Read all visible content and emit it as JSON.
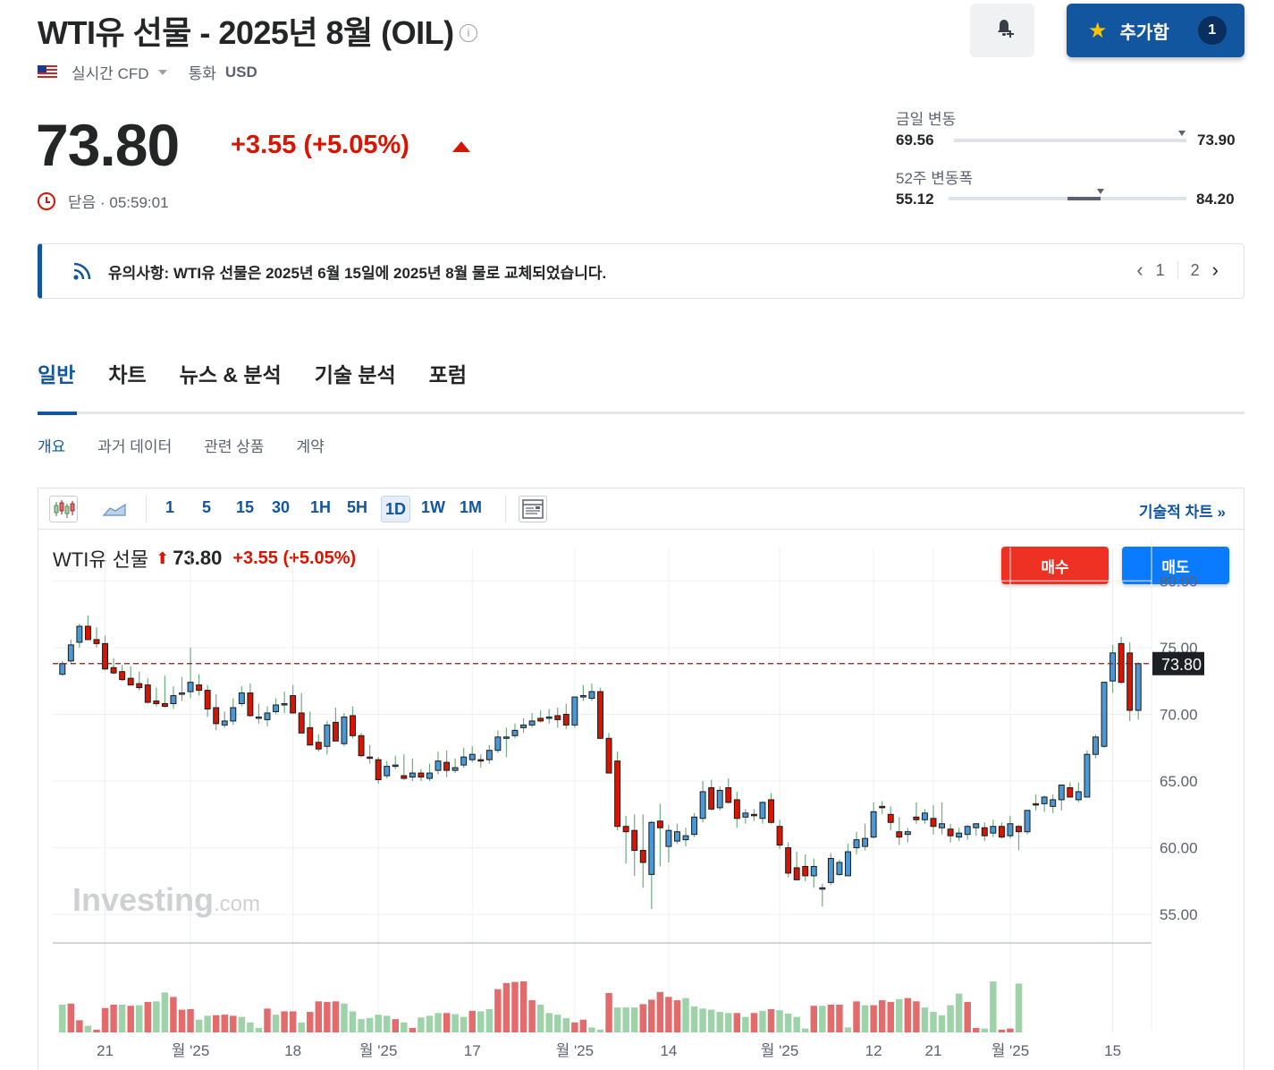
{
  "header": {
    "title": "WTI유 선물 - 2025년 8월 (OIL)",
    "info_icon": "i",
    "follow_label": "추가함",
    "follow_count": "1"
  },
  "subheader": {
    "market_type": "실시간 CFD",
    "currency_label": "통화",
    "currency": "USD"
  },
  "quote": {
    "price": "73.80",
    "change": "+3.55 (+5.05%)",
    "status": "닫음 · 05:59:01"
  },
  "ranges": {
    "day_label": "금일 변동",
    "day_low": "69.56",
    "day_high": "73.90",
    "day_position": 0.98,
    "week52_label": "52주 변동폭",
    "week52_low": "55.12",
    "week52_high": "84.20",
    "week52_fill_start": 0.5,
    "week52_position": 0.64
  },
  "notice": {
    "text": "유의사항: WTI유 선물은 2025년 6월 15일에 2025년 8월 물로 교체되었습니다.",
    "page_current": "1",
    "page_total": "2"
  },
  "tabs": [
    "일반",
    "차트",
    "뉴스 & 분석",
    "기술 분석",
    "포럼"
  ],
  "subtabs": [
    "개요",
    "과거 데이터",
    "관련 상품",
    "계약"
  ],
  "toolbar": {
    "intervals": [
      "1",
      "5",
      "15",
      "30",
      "1H",
      "5H",
      "1D",
      "1W",
      "1M"
    ],
    "selected_interval": "1D",
    "tech_chart_link": "기술적 차트 »"
  },
  "chart_legend": {
    "name": "WTI유 선물",
    "price": "73.80",
    "change": "+3.55 (+5.05%)"
  },
  "buttons": {
    "buy": "매수",
    "sell": "매도"
  },
  "watermark": {
    "brand": "Investing",
    "suffix": ".com"
  },
  "colors": {
    "accent": "#1256a0",
    "up": "#d91400",
    "candle_up": "#4a98d4",
    "candle_down": "#d91400",
    "volume_up": "#9ed3a9",
    "volume_down": "#e46b6b"
  },
  "chart_data": {
    "type": "candlestick",
    "ylim": [
      53,
      82.5
    ],
    "y_ticks": [
      80,
      75,
      70,
      65,
      60,
      55
    ],
    "y_tick_labels": [
      "80.00",
      "75.00",
      "70.00",
      "65.00",
      "60.00",
      "55.00"
    ],
    "last_price": 73.8,
    "last_price_label": "73.80",
    "x_tick_labels": [
      "21",
      "월 '25",
      "18",
      "월 '25",
      "17",
      "월 '25",
      "14",
      "월 '25",
      "12",
      "21",
      "월 '25",
      "15"
    ],
    "x_tick_positions": [
      5,
      15,
      27,
      37,
      48,
      60,
      71,
      84,
      95,
      102,
      111,
      123
    ],
    "candles": [
      [
        73.0,
        74.0,
        72.9,
        73.8
      ],
      [
        74.0,
        75.6,
        73.8,
        75.2
      ],
      [
        75.4,
        76.8,
        75.0,
        76.6
      ],
      [
        76.6,
        77.4,
        75.9,
        75.6
      ],
      [
        75.6,
        76.5,
        75.0,
        75.3
      ],
      [
        75.3,
        75.9,
        73.3,
        73.4
      ],
      [
        73.5,
        74.2,
        73.0,
        73.1
      ],
      [
        73.2,
        73.7,
        72.5,
        72.6
      ],
      [
        72.7,
        73.6,
        72.2,
        72.2
      ],
      [
        72.3,
        73.2,
        71.8,
        72.0
      ],
      [
        72.2,
        72.7,
        70.8,
        70.9
      ],
      [
        71.0,
        72.0,
        70.6,
        70.8
      ],
      [
        70.8,
        72.9,
        70.5,
        70.6
      ],
      [
        70.8,
        72.1,
        70.4,
        71.4
      ],
      [
        71.6,
        72.8,
        71.0,
        71.6
      ],
      [
        71.7,
        75.0,
        71.2,
        72.4
      ],
      [
        72.2,
        73.0,
        71.4,
        71.8
      ],
      [
        71.8,
        72.2,
        69.8,
        70.4
      ],
      [
        70.5,
        71.5,
        68.8,
        69.3
      ],
      [
        69.2,
        70.2,
        69.0,
        69.5
      ],
      [
        69.5,
        71.2,
        69.2,
        70.5
      ],
      [
        70.8,
        72.1,
        70.6,
        71.6
      ],
      [
        71.6,
        72.3,
        69.8,
        69.9
      ],
      [
        69.7,
        70.8,
        69.3,
        69.8
      ],
      [
        69.6,
        70.6,
        69.1,
        70.1
      ],
      [
        70.2,
        71.2,
        70.0,
        70.7
      ],
      [
        70.8,
        71.7,
        70.1,
        70.8
      ],
      [
        71.4,
        72.2,
        70.8,
        70.1
      ],
      [
        70.1,
        71.6,
        69.3,
        68.6
      ],
      [
        69.0,
        70.2,
        68.3,
        67.7
      ],
      [
        67.9,
        68.5,
        67.2,
        67.4
      ],
      [
        67.6,
        69.5,
        67.0,
        69.2
      ],
      [
        69.4,
        70.5,
        68.1,
        68.0
      ],
      [
        67.8,
        70.1,
        67.6,
        69.8
      ],
      [
        69.9,
        70.6,
        68.2,
        68.4
      ],
      [
        68.4,
        68.6,
        66.8,
        66.9
      ],
      [
        66.8,
        67.7,
        66.3,
        66.7
      ],
      [
        66.6,
        66.8,
        64.8,
        65.1
      ],
      [
        65.4,
        66.5,
        65.2,
        66.1
      ],
      [
        66.1,
        66.9,
        65.9,
        66.2
      ],
      [
        65.4,
        67.0,
        65.1,
        65.2
      ],
      [
        65.3,
        66.7,
        65.0,
        65.6
      ],
      [
        65.6,
        65.9,
        65.0,
        65.3
      ],
      [
        65.2,
        66.3,
        65.0,
        65.6
      ],
      [
        65.8,
        67.2,
        65.5,
        66.5
      ],
      [
        66.4,
        67.3,
        65.3,
        65.8
      ],
      [
        65.8,
        66.7,
        65.6,
        66.0
      ],
      [
        66.2,
        67.5,
        66.0,
        66.8
      ],
      [
        66.6,
        67.6,
        66.4,
        67.0
      ],
      [
        66.6,
        67.0,
        66.0,
        66.5
      ],
      [
        66.6,
        67.7,
        66.3,
        67.3
      ],
      [
        67.3,
        68.8,
        67.1,
        68.3
      ],
      [
        68.2,
        69.0,
        66.8,
        68.3
      ],
      [
        68.4,
        69.3,
        68.2,
        68.8
      ],
      [
        69.0,
        69.7,
        68.6,
        69.2
      ],
      [
        69.2,
        70.1,
        69.0,
        69.5
      ],
      [
        69.7,
        70.3,
        69.4,
        69.5
      ],
      [
        69.7,
        70.4,
        69.3,
        69.8
      ],
      [
        69.9,
        70.5,
        69.0,
        69.6
      ],
      [
        70.0,
        70.8,
        68.9,
        69.2
      ],
      [
        69.2,
        71.3,
        69.0,
        71.3
      ],
      [
        71.3,
        72.2,
        71.0,
        71.4
      ],
      [
        71.2,
        72.3,
        71.0,
        71.7
      ],
      [
        71.7,
        72.0,
        68.5,
        68.2
      ],
      [
        68.2,
        68.6,
        66.2,
        65.6
      ],
      [
        66.5,
        67.2,
        61.3,
        61.6
      ],
      [
        61.6,
        62.4,
        58.8,
        61.2
      ],
      [
        61.3,
        62.5,
        57.9,
        59.8
      ],
      [
        59.8,
        62.5,
        57.0,
        58.9
      ],
      [
        58.0,
        62.0,
        55.4,
        61.9
      ],
      [
        62.0,
        63.3,
        58.6,
        61.5
      ],
      [
        60.1,
        61.7,
        58.9,
        61.3
      ],
      [
        60.5,
        61.8,
        60.3,
        61.2
      ],
      [
        60.6,
        61.5,
        60.1,
        60.9
      ],
      [
        61.0,
        62.6,
        60.8,
        62.3
      ],
      [
        62.2,
        65.0,
        61.9,
        64.2
      ],
      [
        64.5,
        65.1,
        62.8,
        62.9
      ],
      [
        63.0,
        64.6,
        62.8,
        64.3
      ],
      [
        64.5,
        65.2,
        63.3,
        63.4
      ],
      [
        63.6,
        64.2,
        61.5,
        62.2
      ],
      [
        62.3,
        62.9,
        61.8,
        62.6
      ],
      [
        62.5,
        62.9,
        62.0,
        62.4
      ],
      [
        62.2,
        63.5,
        61.8,
        63.4
      ],
      [
        63.6,
        64.1,
        61.8,
        61.9
      ],
      [
        61.6,
        62.1,
        59.9,
        60.2
      ],
      [
        60.0,
        60.4,
        57.8,
        58.1
      ],
      [
        58.5,
        59.7,
        57.6,
        57.6
      ],
      [
        58.6,
        59.5,
        57.5,
        57.9
      ],
      [
        57.9,
        59.2,
        57.0,
        58.6
      ],
      [
        57.0,
        57.3,
        55.6,
        57.0
      ],
      [
        57.4,
        59.6,
        57.2,
        59.2
      ],
      [
        58.0,
        59.1,
        57.9,
        58.9
      ],
      [
        57.9,
        60.3,
        57.9,
        59.7
      ],
      [
        60.0,
        61.2,
        59.5,
        60.6
      ],
      [
        60.1,
        61.8,
        59.8,
        60.7
      ],
      [
        60.8,
        63.4,
        60.7,
        62.7
      ],
      [
        63.1,
        63.5,
        62.5,
        63.0
      ],
      [
        62.5,
        63.1,
        61.3,
        61.9
      ],
      [
        61.2,
        62.3,
        60.2,
        60.8
      ],
      [
        61.0,
        61.5,
        60.4,
        61.2
      ],
      [
        62.3,
        63.4,
        61.8,
        62.1
      ],
      [
        62.1,
        62.9,
        61.8,
        62.6
      ],
      [
        62.2,
        63.2,
        61.0,
        61.6
      ],
      [
        61.5,
        63.4,
        61.0,
        61.8
      ],
      [
        61.4,
        61.8,
        60.4,
        60.9
      ],
      [
        60.8,
        61.5,
        60.5,
        61.1
      ],
      [
        61.0,
        61.7,
        60.6,
        61.6
      ],
      [
        61.5,
        61.7,
        60.9,
        61.8
      ],
      [
        61.5,
        61.9,
        60.5,
        60.9
      ],
      [
        61.1,
        62.1,
        60.8,
        61.6
      ],
      [
        61.6,
        61.9,
        60.7,
        60.8
      ],
      [
        60.9,
        62.4,
        60.7,
        61.8
      ],
      [
        61.6,
        61.7,
        59.8,
        61.2
      ],
      [
        61.2,
        62.8,
        61.0,
        62.8
      ],
      [
        63.3,
        64.0,
        62.8,
        63.2
      ],
      [
        63.3,
        63.9,
        62.7,
        63.8
      ],
      [
        63.1,
        64.0,
        62.6,
        63.6
      ],
      [
        63.6,
        64.4,
        62.8,
        64.7
      ],
      [
        64.5,
        64.9,
        64.3,
        63.8
      ],
      [
        63.6,
        64.9,
        63.4,
        64.2
      ],
      [
        63.8,
        67.3,
        63.8,
        67.0
      ],
      [
        67.0,
        68.5,
        66.7,
        68.3
      ],
      [
        67.6,
        71.8,
        67.5,
        72.4
      ],
      [
        72.5,
        75.2,
        71.6,
        74.6
      ],
      [
        75.3,
        75.8,
        72.3,
        72.4
      ],
      [
        74.6,
        75.4,
        69.5,
        70.3
      ],
      [
        70.3,
        73.9,
        69.6,
        73.8
      ]
    ],
    "volume": [
      [
        0.5,
        "u"
      ],
      [
        0.52,
        "d"
      ],
      [
        0.22,
        "d"
      ],
      [
        0.12,
        "u"
      ],
      [
        0.05,
        "d"
      ],
      [
        0.44,
        "d"
      ],
      [
        0.5,
        "d"
      ],
      [
        0.5,
        "u"
      ],
      [
        0.48,
        "d"
      ],
      [
        0.49,
        "u"
      ],
      [
        0.55,
        "d"
      ],
      [
        0.56,
        "u"
      ],
      [
        0.72,
        "u"
      ],
      [
        0.64,
        "d"
      ],
      [
        0.41,
        "d"
      ],
      [
        0.42,
        "d"
      ],
      [
        0.23,
        "u"
      ],
      [
        0.3,
        "u"
      ],
      [
        0.31,
        "d"
      ],
      [
        0.32,
        "d"
      ],
      [
        0.3,
        "d"
      ],
      [
        0.28,
        "u"
      ],
      [
        0.18,
        "u"
      ],
      [
        0.08,
        "u"
      ],
      [
        0.43,
        "d"
      ],
      [
        0.32,
        "u"
      ],
      [
        0.38,
        "d"
      ],
      [
        0.38,
        "d"
      ],
      [
        0.18,
        "u"
      ],
      [
        0.37,
        "d"
      ],
      [
        0.56,
        "d"
      ],
      [
        0.55,
        "d"
      ],
      [
        0.56,
        "d"
      ],
      [
        0.52,
        "u"
      ],
      [
        0.38,
        "u"
      ],
      [
        0.24,
        "u"
      ],
      [
        0.26,
        "u"
      ],
      [
        0.32,
        "u"
      ],
      [
        0.3,
        "u"
      ],
      [
        0.24,
        "d"
      ],
      [
        0.18,
        "u"
      ],
      [
        0.08,
        "d"
      ],
      [
        0.27,
        "u"
      ],
      [
        0.3,
        "u"
      ],
      [
        0.35,
        "u"
      ],
      [
        0.35,
        "d"
      ],
      [
        0.33,
        "u"
      ],
      [
        0.28,
        "u"
      ],
      [
        0.39,
        "d"
      ],
      [
        0.38,
        "u"
      ],
      [
        0.42,
        "u"
      ],
      [
        0.78,
        "d"
      ],
      [
        0.89,
        "d"
      ],
      [
        0.91,
        "d"
      ],
      [
        0.92,
        "d"
      ],
      [
        0.58,
        "d"
      ],
      [
        0.5,
        "u"
      ],
      [
        0.35,
        "u"
      ],
      [
        0.32,
        "u"
      ],
      [
        0.26,
        "u"
      ],
      [
        0.18,
        "d"
      ],
      [
        0.23,
        "d"
      ],
      [
        0.09,
        "u"
      ],
      [
        0.05,
        "u"
      ],
      [
        0.71,
        "d"
      ],
      [
        0.45,
        "u"
      ],
      [
        0.45,
        "u"
      ],
      [
        0.45,
        "u"
      ],
      [
        0.51,
        "d"
      ],
      [
        0.59,
        "d"
      ],
      [
        0.73,
        "d"
      ],
      [
        0.64,
        "d"
      ],
      [
        0.58,
        "d"
      ],
      [
        0.62,
        "u"
      ],
      [
        0.47,
        "u"
      ],
      [
        0.43,
        "u"
      ],
      [
        0.41,
        "u"
      ],
      [
        0.37,
        "u"
      ],
      [
        0.35,
        "u"
      ],
      [
        0.35,
        "d"
      ],
      [
        0.28,
        "u"
      ],
      [
        0.35,
        "d"
      ],
      [
        0.39,
        "u"
      ],
      [
        0.42,
        "d"
      ],
      [
        0.4,
        "u"
      ],
      [
        0.34,
        "u"
      ],
      [
        0.28,
        "u"
      ],
      [
        0.07,
        "u"
      ],
      [
        0.48,
        "d"
      ],
      [
        0.48,
        "u"
      ],
      [
        0.5,
        "d"
      ],
      [
        0.5,
        "d"
      ],
      [
        0.09,
        "u"
      ],
      [
        0.56,
        "d"
      ],
      [
        0.49,
        "u"
      ],
      [
        0.49,
        "d"
      ],
      [
        0.58,
        "d"
      ],
      [
        0.55,
        "d"
      ],
      [
        0.6,
        "u"
      ],
      [
        0.62,
        "d"
      ],
      [
        0.56,
        "d"
      ],
      [
        0.45,
        "u"
      ],
      [
        0.37,
        "u"
      ],
      [
        0.31,
        "u"
      ],
      [
        0.49,
        "u"
      ],
      [
        0.7,
        "u"
      ],
      [
        0.55,
        "d"
      ],
      [
        0.08,
        "d"
      ],
      [
        0.07,
        "u"
      ],
      [
        0.92,
        "u"
      ],
      [
        0.05,
        "d"
      ],
      [
        0.07,
        "d"
      ],
      [
        0.88,
        "u"
      ]
    ]
  }
}
